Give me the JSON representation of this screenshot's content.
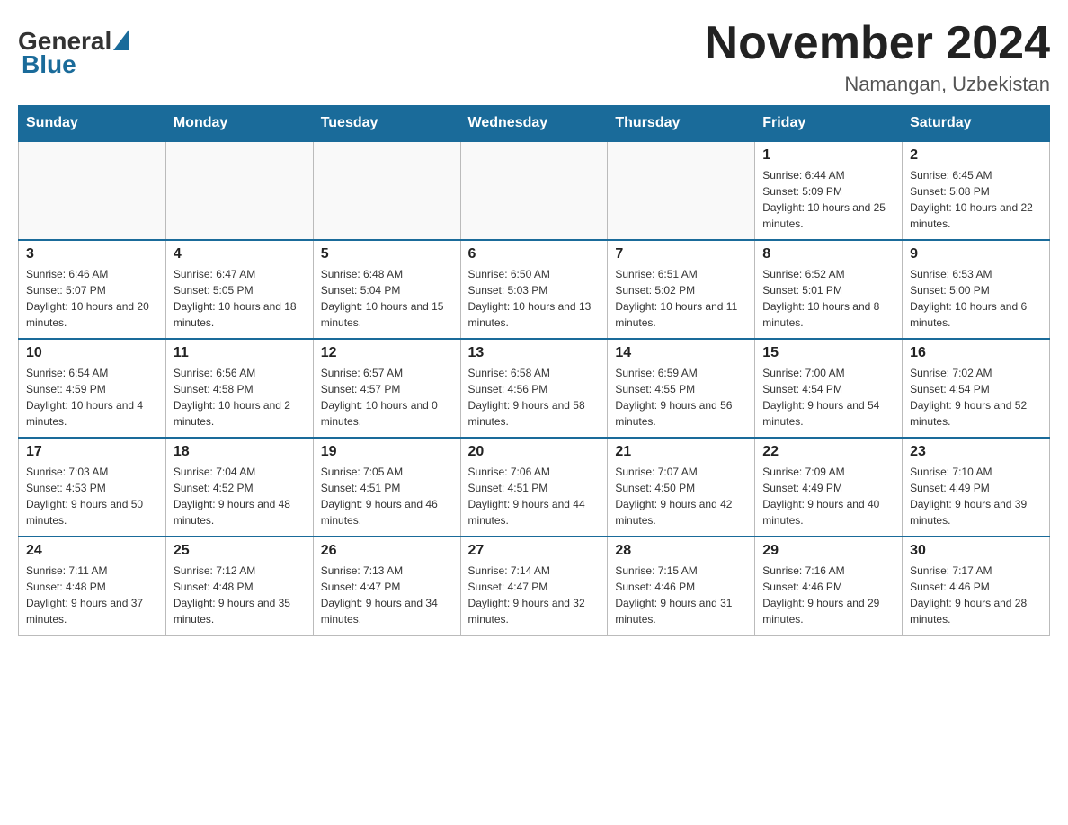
{
  "header": {
    "logo_general": "General",
    "logo_blue": "Blue",
    "month_title": "November 2024",
    "location": "Namangan, Uzbekistan"
  },
  "weekdays": [
    "Sunday",
    "Monday",
    "Tuesday",
    "Wednesday",
    "Thursday",
    "Friday",
    "Saturday"
  ],
  "weeks": [
    [
      {
        "day": "",
        "info": ""
      },
      {
        "day": "",
        "info": ""
      },
      {
        "day": "",
        "info": ""
      },
      {
        "day": "",
        "info": ""
      },
      {
        "day": "",
        "info": ""
      },
      {
        "day": "1",
        "info": "Sunrise: 6:44 AM\nSunset: 5:09 PM\nDaylight: 10 hours and 25 minutes."
      },
      {
        "day": "2",
        "info": "Sunrise: 6:45 AM\nSunset: 5:08 PM\nDaylight: 10 hours and 22 minutes."
      }
    ],
    [
      {
        "day": "3",
        "info": "Sunrise: 6:46 AM\nSunset: 5:07 PM\nDaylight: 10 hours and 20 minutes."
      },
      {
        "day": "4",
        "info": "Sunrise: 6:47 AM\nSunset: 5:05 PM\nDaylight: 10 hours and 18 minutes."
      },
      {
        "day": "5",
        "info": "Sunrise: 6:48 AM\nSunset: 5:04 PM\nDaylight: 10 hours and 15 minutes."
      },
      {
        "day": "6",
        "info": "Sunrise: 6:50 AM\nSunset: 5:03 PM\nDaylight: 10 hours and 13 minutes."
      },
      {
        "day": "7",
        "info": "Sunrise: 6:51 AM\nSunset: 5:02 PM\nDaylight: 10 hours and 11 minutes."
      },
      {
        "day": "8",
        "info": "Sunrise: 6:52 AM\nSunset: 5:01 PM\nDaylight: 10 hours and 8 minutes."
      },
      {
        "day": "9",
        "info": "Sunrise: 6:53 AM\nSunset: 5:00 PM\nDaylight: 10 hours and 6 minutes."
      }
    ],
    [
      {
        "day": "10",
        "info": "Sunrise: 6:54 AM\nSunset: 4:59 PM\nDaylight: 10 hours and 4 minutes."
      },
      {
        "day": "11",
        "info": "Sunrise: 6:56 AM\nSunset: 4:58 PM\nDaylight: 10 hours and 2 minutes."
      },
      {
        "day": "12",
        "info": "Sunrise: 6:57 AM\nSunset: 4:57 PM\nDaylight: 10 hours and 0 minutes."
      },
      {
        "day": "13",
        "info": "Sunrise: 6:58 AM\nSunset: 4:56 PM\nDaylight: 9 hours and 58 minutes."
      },
      {
        "day": "14",
        "info": "Sunrise: 6:59 AM\nSunset: 4:55 PM\nDaylight: 9 hours and 56 minutes."
      },
      {
        "day": "15",
        "info": "Sunrise: 7:00 AM\nSunset: 4:54 PM\nDaylight: 9 hours and 54 minutes."
      },
      {
        "day": "16",
        "info": "Sunrise: 7:02 AM\nSunset: 4:54 PM\nDaylight: 9 hours and 52 minutes."
      }
    ],
    [
      {
        "day": "17",
        "info": "Sunrise: 7:03 AM\nSunset: 4:53 PM\nDaylight: 9 hours and 50 minutes."
      },
      {
        "day": "18",
        "info": "Sunrise: 7:04 AM\nSunset: 4:52 PM\nDaylight: 9 hours and 48 minutes."
      },
      {
        "day": "19",
        "info": "Sunrise: 7:05 AM\nSunset: 4:51 PM\nDaylight: 9 hours and 46 minutes."
      },
      {
        "day": "20",
        "info": "Sunrise: 7:06 AM\nSunset: 4:51 PM\nDaylight: 9 hours and 44 minutes."
      },
      {
        "day": "21",
        "info": "Sunrise: 7:07 AM\nSunset: 4:50 PM\nDaylight: 9 hours and 42 minutes."
      },
      {
        "day": "22",
        "info": "Sunrise: 7:09 AM\nSunset: 4:49 PM\nDaylight: 9 hours and 40 minutes."
      },
      {
        "day": "23",
        "info": "Sunrise: 7:10 AM\nSunset: 4:49 PM\nDaylight: 9 hours and 39 minutes."
      }
    ],
    [
      {
        "day": "24",
        "info": "Sunrise: 7:11 AM\nSunset: 4:48 PM\nDaylight: 9 hours and 37 minutes."
      },
      {
        "day": "25",
        "info": "Sunrise: 7:12 AM\nSunset: 4:48 PM\nDaylight: 9 hours and 35 minutes."
      },
      {
        "day": "26",
        "info": "Sunrise: 7:13 AM\nSunset: 4:47 PM\nDaylight: 9 hours and 34 minutes."
      },
      {
        "day": "27",
        "info": "Sunrise: 7:14 AM\nSunset: 4:47 PM\nDaylight: 9 hours and 32 minutes."
      },
      {
        "day": "28",
        "info": "Sunrise: 7:15 AM\nSunset: 4:46 PM\nDaylight: 9 hours and 31 minutes."
      },
      {
        "day": "29",
        "info": "Sunrise: 7:16 AM\nSunset: 4:46 PM\nDaylight: 9 hours and 29 minutes."
      },
      {
        "day": "30",
        "info": "Sunrise: 7:17 AM\nSunset: 4:46 PM\nDaylight: 9 hours and 28 minutes."
      }
    ]
  ]
}
